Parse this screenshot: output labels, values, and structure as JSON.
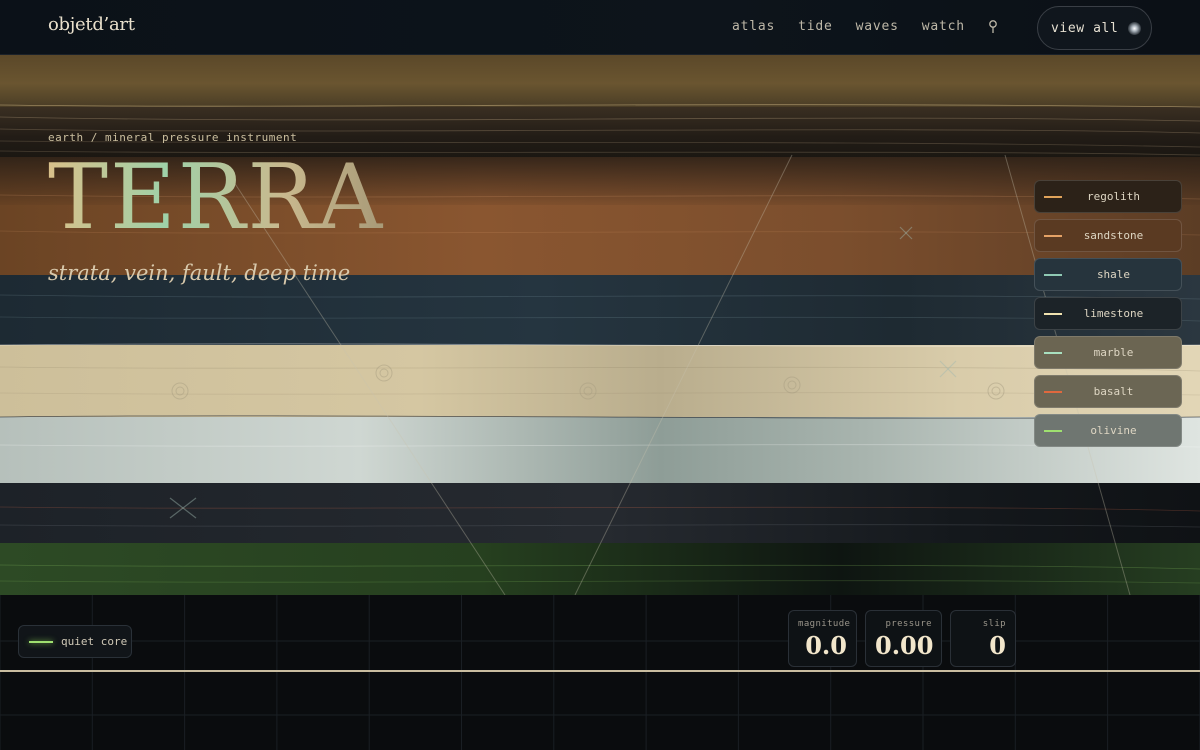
{
  "header": {
    "brand": "objetd’art",
    "nav": [
      "atlas",
      "tide",
      "waves",
      "watch"
    ],
    "view_all": "view all",
    "icons": {
      "pin": "location-pin-icon",
      "orb": "glowing-orb-icon"
    }
  },
  "hero": {
    "breadcrumb": "earth / mineral pressure instrument",
    "title": "TERRA",
    "subtitle": "strata, vein, fault, deep time"
  },
  "legend": {
    "items": [
      {
        "label": "regolith",
        "color": "#e0a35a",
        "bg": "#2c2218"
      },
      {
        "label": "sandstone",
        "color": "#e5a266",
        "bg": "#5a3a22"
      },
      {
        "label": "shale",
        "color": "#8fc9b4",
        "bg": "#26343d"
      },
      {
        "label": "limestone",
        "color": "#f0e2b0",
        "bg": "#1c2328"
      },
      {
        "label": "marble",
        "color": "#a8e0c0",
        "bg": "#6b6552"
      },
      {
        "label": "basalt",
        "color": "#e0683e",
        "bg": "#6b6654"
      },
      {
        "label": "olivine",
        "color": "#9fe070",
        "bg": "#6f7671"
      }
    ]
  },
  "status": {
    "core_label": "quiet core",
    "core_color": "#9fe070",
    "meters": [
      {
        "key": "magnitude",
        "value": "0.0"
      },
      {
        "key": "pressure",
        "value": "0.00"
      },
      {
        "key": "slip",
        "value": "0"
      }
    ]
  }
}
